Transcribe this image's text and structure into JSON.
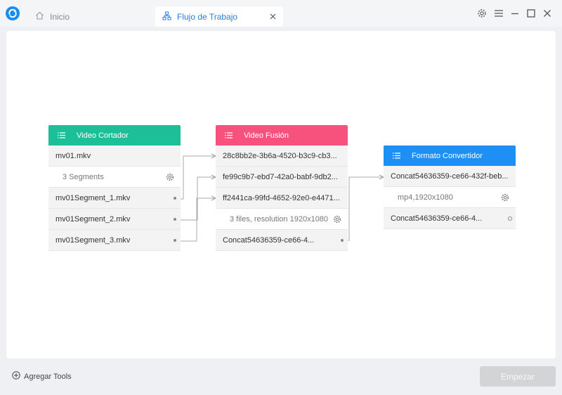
{
  "window": {
    "tabs": [
      {
        "label": "Inicio",
        "icon": "home-icon"
      },
      {
        "label": "Flujo de Trabajo",
        "icon": "workflow-icon"
      }
    ]
  },
  "nodes": {
    "cutter": {
      "title": "Video Cortador",
      "color": "#1dbf98",
      "input": "mv01.mkv",
      "setting": "3 Segments",
      "outputs": [
        "mv01Segment_1.mkv",
        "mv01Segment_2.mkv",
        "mv01Segment_3.mkv"
      ]
    },
    "merge": {
      "title": "Video Fusión",
      "color": "#f6527d",
      "inputs": [
        "28c8bb2e-3b6a-4520-b3c9-cb3...",
        "fe99c9b7-ebd7-42a0-babf-9db2...",
        "ff2441ca-99fd-4652-92e0-e4471..."
      ],
      "setting": "3 files, resolution 1920x1080",
      "output": "Concat54636359-ce66-4..."
    },
    "convert": {
      "title": "Formato Convertidor",
      "color": "#1e90f5",
      "input": "Concat54636359-ce66-432f-beb...",
      "setting": "mp4,1920x1080",
      "output": "Concat54636359-ce66-4..."
    }
  },
  "footer": {
    "add_tools": "Agregar Tools",
    "start": "Empezar"
  }
}
